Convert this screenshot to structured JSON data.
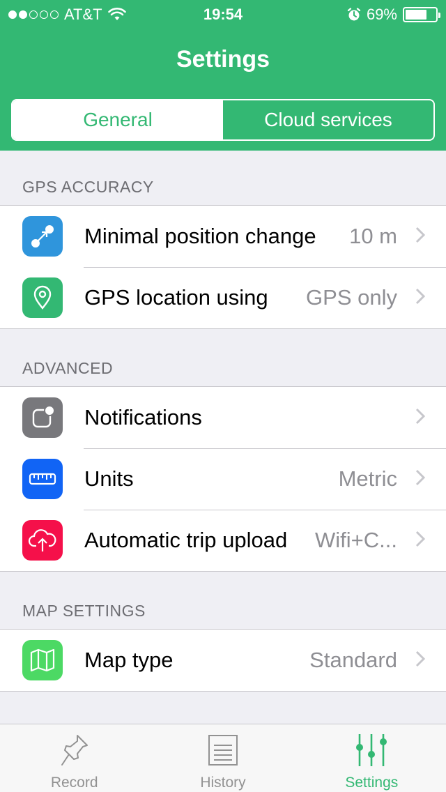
{
  "status_bar": {
    "carrier": "AT&T",
    "time": "19:54",
    "battery": "69%",
    "signal_bars_filled": 2,
    "signal_bars_total": 5,
    "battery_level": 0.69
  },
  "header": {
    "title": "Settings",
    "segments": [
      {
        "label": "General",
        "active": true
      },
      {
        "label": "Cloud services",
        "active": false
      }
    ]
  },
  "sections": [
    {
      "title": "GPS ACCURACY",
      "rows": [
        {
          "label": "Minimal position change",
          "value": "10 m",
          "icon": "position-change-icon",
          "color": "#2f95dc"
        },
        {
          "label": "GPS location using",
          "value": "GPS only",
          "icon": "location-pin-icon",
          "color": "#33b873"
        }
      ]
    },
    {
      "title": "ADVANCED",
      "rows": [
        {
          "label": "Notifications",
          "value": "",
          "icon": "notifications-icon",
          "color": "#78787c"
        },
        {
          "label": "Units",
          "value": "Metric",
          "icon": "ruler-icon",
          "color": "#1164f5"
        },
        {
          "label": "Automatic trip upload",
          "value": "Wifi+C...",
          "icon": "cloud-upload-icon",
          "color": "#f5104a"
        }
      ]
    },
    {
      "title": "MAP SETTINGS",
      "rows": [
        {
          "label": "Map type",
          "value": "Standard",
          "icon": "map-icon",
          "color": "#4cd964"
        }
      ]
    }
  ],
  "tabbar": {
    "tabs": [
      {
        "label": "Record",
        "icon": "pushpin-icon",
        "active": false
      },
      {
        "label": "History",
        "icon": "history-list-icon",
        "active": false
      },
      {
        "label": "Settings",
        "icon": "sliders-icon",
        "active": true
      }
    ]
  },
  "colors": {
    "accent": "#33b873",
    "inactive_tab": "#929292",
    "secondary_text": "#8e8e93"
  }
}
